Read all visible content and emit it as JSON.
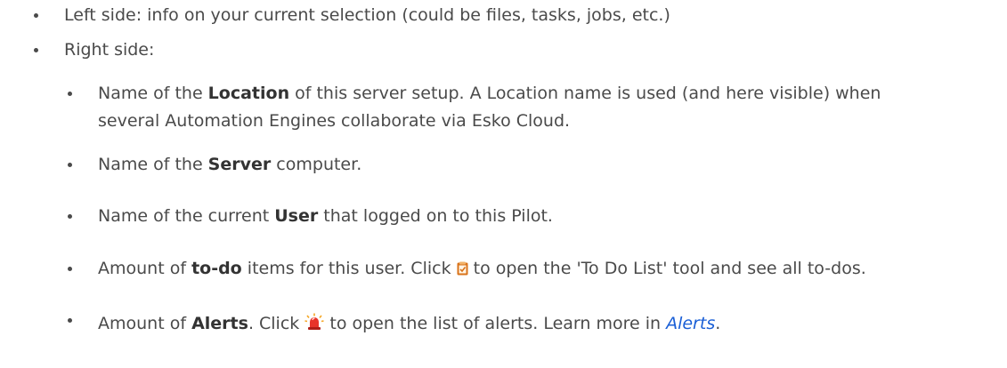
{
  "items": {
    "left_side": "Left side: info on your current selection (could be files, tasks, jobs, etc.)",
    "right_side": "Right side:",
    "location": {
      "pre": "Name of the ",
      "bold": "Location",
      "post_line1": " of this server setup. A Location name is used (and here visible) when",
      "line2": "several Automation Engines collaborate via Esko Cloud."
    },
    "server": {
      "pre": "Name of the ",
      "bold": "Server",
      "post": " computer."
    },
    "user": {
      "pre": "Name of the current ",
      "bold": "User",
      "post": " that logged on to this Pilot."
    },
    "todo": {
      "pre": "Amount of ",
      "bold": "to-do",
      "mid": " items for this user. Click ",
      "post": " to open the 'To Do List' tool and see all to-dos."
    },
    "alerts": {
      "pre": "Amount of ",
      "bold": "Alerts",
      "mid": ". Click ",
      "post": " to open the list of alerts. Learn more in ",
      "link": "Alerts",
      "end": "."
    }
  },
  "icons": {
    "todo": "todo-list-icon",
    "alerts": "alert-siren-icon"
  },
  "colors": {
    "text": "#4a4a4a",
    "link": "#1a5fd6",
    "todo_icon": "#d9731a",
    "alert_icon": "#e8332a"
  }
}
